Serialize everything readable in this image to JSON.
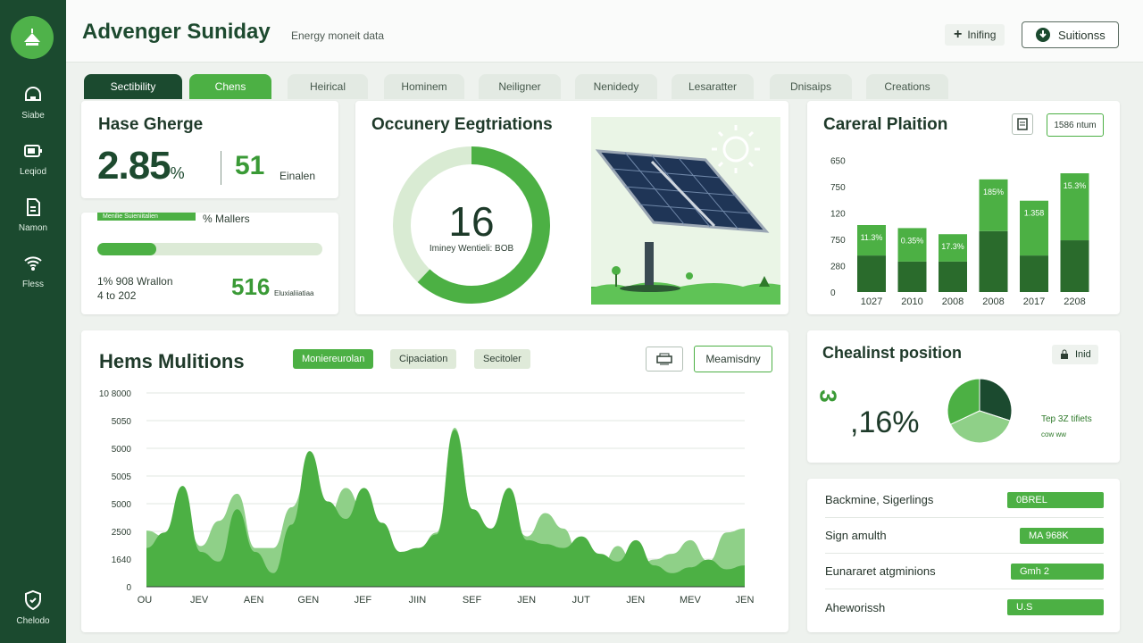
{
  "app": {
    "title": "Advenger Suniday",
    "subtitle": "Energy moneit data",
    "btn_add": "Inifing",
    "btn_solutions": "Suitionss"
  },
  "sidebar": {
    "items": [
      {
        "label": "Siabe"
      },
      {
        "label": "Leqiod"
      },
      {
        "label": "Namon"
      },
      {
        "label": "Fless"
      },
      {
        "label": "Chelodo"
      }
    ]
  },
  "tabs": [
    {
      "label": "Sectibility"
    },
    {
      "label": "Chens"
    },
    {
      "label": "Heirical"
    },
    {
      "label": "Hominem"
    },
    {
      "label": "Neiligner"
    },
    {
      "label": "Nenidedy"
    },
    {
      "label": "Lesaratter"
    },
    {
      "label": "Dnisaips"
    },
    {
      "label": "Creations"
    }
  ],
  "card1": {
    "title": "Hase Gherge",
    "value": "2.85",
    "value_suffix": "%",
    "secondary": "51",
    "secondary_label": "Einalen"
  },
  "card2": {
    "bar_label": "Menilie Suieniitalien",
    "stat_label": "% Mallers",
    "progress": 0.26,
    "line1": "1% 908 Wrallon",
    "line2": "4 to 202",
    "value": "516",
    "value_label": "Eluxialiiatiaa"
  },
  "occupancy": {
    "title": "Occunery Eegtriations",
    "value": "16",
    "label": "Iminey Wentieli: BOB",
    "fraction": 0.62
  },
  "capital": {
    "title": "Careral Plaition",
    "badge": "1586 ntum",
    "chart_data": {
      "type": "bar",
      "categories": [
        "1027",
        "2010",
        "2008",
        "2008",
        "2017",
        "2208"
      ],
      "yticks": [
        "0",
        "280",
        "750",
        "120",
        "750",
        "650"
      ],
      "series": [
        {
          "values": [
            1.2,
            1.0,
            1.0,
            2.0,
            1.2,
            1.7
          ]
        },
        {
          "values": [
            1.0,
            1.1,
            0.9,
            1.7,
            1.8,
            2.2
          ]
        }
      ],
      "labels": [
        "11.3%",
        "0.35%",
        "17.3%",
        "185%",
        "1.358",
        "15.3%"
      ]
    }
  },
  "hems": {
    "title": "Hems Mulitions",
    "chips": [
      "Moniereurolan",
      "Cipaciation",
      "Secitoler"
    ],
    "button": "Meamisdny",
    "chart_data": {
      "type": "area",
      "xlabels": [
        "OU",
        "JEV",
        "AEN",
        "GEN",
        "JEF",
        "JIIN",
        "SEF",
        "JEN",
        "JUT",
        "JEN",
        "MEV",
        "JEN"
      ],
      "ylabels": [
        "10 8000",
        "5050",
        "5000",
        "5005",
        "5000",
        "2500",
        "1640",
        "0"
      ],
      "series": [
        {
          "values": [
            2900,
            2600,
            4000,
            2100,
            3400,
            4800,
            2000,
            2000,
            4100,
            6000,
            3600,
            5100,
            3900,
            2500,
            800,
            1900,
            2800,
            8200,
            4000,
            3000,
            3800,
            2600,
            3800,
            3000,
            1200,
            900,
            2100,
            900,
            1400,
            1700,
            2400,
            1300,
            2800,
            3000
          ]
        },
        {
          "values": [
            2000,
            2800,
            5200,
            1800,
            1300,
            4000,
            1800,
            700,
            3200,
            7000,
            4400,
            3500,
            5100,
            3300,
            1800,
            2000,
            2700,
            8100,
            4000,
            3000,
            5100,
            2400,
            2200,
            2000,
            2600,
            1700,
            1300,
            2400,
            1100,
            700,
            1000,
            1400,
            900,
            1100
          ]
        }
      ]
    }
  },
  "position": {
    "title": "Chealinst position",
    "badge": "Inid",
    "value": ",16%",
    "side_label": "3",
    "top_label": "Tep 3Z tifiets",
    "sub_label": "cow ww",
    "chart_data": {
      "type": "pie",
      "values": [
        30,
        38,
        32
      ]
    }
  },
  "legend_list": [
    {
      "label": "Backmine, Sigerlings",
      "value": "0BREL"
    },
    {
      "label": "Sign amulth",
      "value": "MA 968K"
    },
    {
      "label": "Eunararet atgminions",
      "value": "Gmh 2"
    },
    {
      "label": "Aheworissh",
      "value": "U.S"
    }
  ]
}
